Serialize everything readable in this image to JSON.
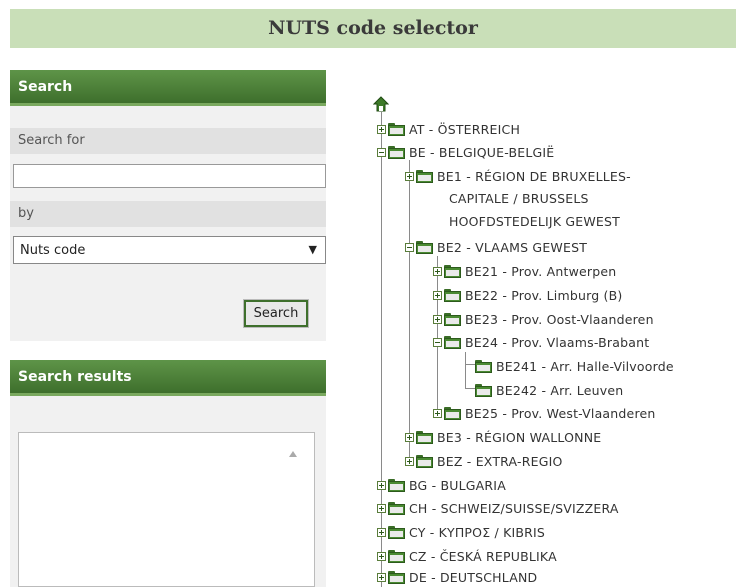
{
  "header": {
    "title": "NUTS code selector"
  },
  "search_panel": {
    "title": "Search",
    "search_for_label": "Search for",
    "search_input_value": "",
    "by_label": "by",
    "by_selected": "Nuts code",
    "search_button": "Search"
  },
  "results_panel": {
    "title": "Search results"
  },
  "tree": {
    "at": "AT - ÖSTERREICH",
    "be": "BE - BELGIQUE-BELGIË",
    "be1_line1": "BE1 - RÉGION DE BRUXELLES-",
    "be1_line2": "CAPITALE / BRUSSELS",
    "be1_line3": "HOOFDSTEDELIJK GEWEST",
    "be2": "BE2 - VLAAMS GEWEST",
    "be21": "BE21 - Prov. Antwerpen",
    "be22": "BE22 - Prov. Limburg (B)",
    "be23": "BE23 - Prov. Oost-Vlaanderen",
    "be24": "BE24 - Prov. Vlaams-Brabant",
    "be241": "BE241 - Arr. Halle-Vilvoorde",
    "be242": "BE242 - Arr. Leuven",
    "be25": "BE25 - Prov. West-Vlaanderen",
    "be3": "BE3 - RÉGION WALLONNE",
    "bez": "BEZ - EXTRA-REGIO",
    "bg": "BG - BULGARIA",
    "ch": "CH - SCHWEIZ/SUISSE/SVIZZERA",
    "cy": "CY - ΚΥΠΡΟΣ / KIBRIS",
    "cz": "CZ - ČESKÁ REPUBLIKA",
    "de": "DE - DEUTSCHLAND"
  }
}
